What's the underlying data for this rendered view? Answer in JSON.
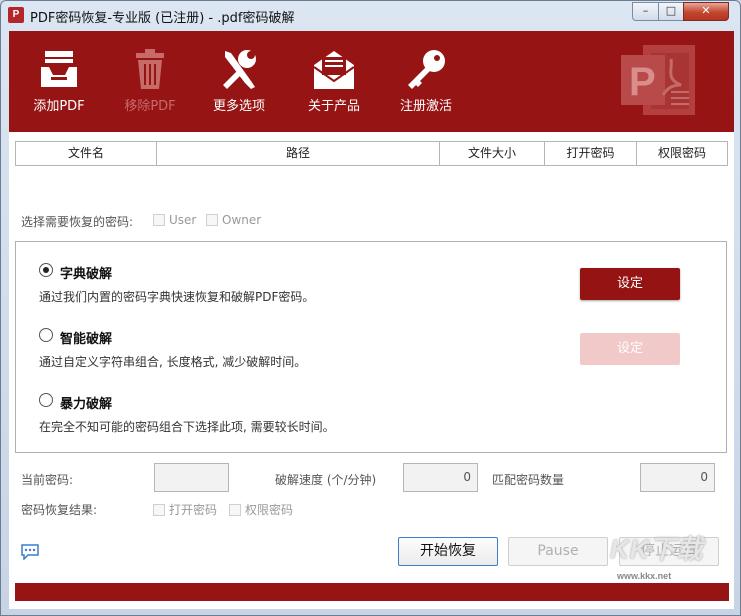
{
  "window": {
    "title": "PDF密码恢复-专业版 (已注册) - .pdf密码破解",
    "app_icon_text": "P",
    "controls": {
      "minimize": "–",
      "maximize": "□",
      "close": "✕"
    }
  },
  "toolbar": {
    "items": [
      {
        "label": "添加PDF",
        "icon": "inbox-tray-icon",
        "enabled": true
      },
      {
        "label": "移除PDF",
        "icon": "trash-icon",
        "enabled": false
      },
      {
        "label": "更多选项",
        "icon": "tools-icon",
        "enabled": true
      },
      {
        "label": "关于产品",
        "icon": "envelope-icon",
        "enabled": true
      },
      {
        "label": "注册激活",
        "icon": "key-icon",
        "enabled": true
      }
    ],
    "logo": "pdf-logo-icon",
    "logo_letter": "P"
  },
  "table": {
    "columns": [
      "文件名",
      "路径",
      "文件大小",
      "打开密码",
      "权限密码"
    ]
  },
  "password_type": {
    "label": "选择需要恢复的密码:",
    "options": [
      "User",
      "Owner"
    ]
  },
  "modes": [
    {
      "title": "字典破解",
      "desc": "通过我们内置的密码字典快速恢复和破解PDF密码。",
      "selected": true,
      "button": "设定",
      "button_enabled": true
    },
    {
      "title": "智能破解",
      "desc": "通过自定义字符串组合, 长度格式, 减少破解时间。",
      "selected": false,
      "button": "设定",
      "button_enabled": false
    },
    {
      "title": "暴力破解",
      "desc": "在完全不知可能的密码组合下选择此项, 需要较长时间。",
      "selected": false
    }
  ],
  "stats": {
    "current_password_label": "当前密码:",
    "current_password_value": "",
    "speed_label": "破解速度 (个/分钟)",
    "speed_value": "0",
    "match_label": "匹配密码数量",
    "match_value": "0",
    "result_label": "密码恢复结果:",
    "result_options": [
      "打开密码",
      "权限密码"
    ]
  },
  "actions": {
    "start": "开始恢复",
    "pause": "Pause",
    "stop": "停止运算"
  },
  "progress": {
    "value": 1.0
  },
  "watermark": {
    "logo": "KK下载",
    "url": "www.kkx.net"
  },
  "colors": {
    "accent": "#961413",
    "disabled_accent": "#f1c9c9"
  }
}
